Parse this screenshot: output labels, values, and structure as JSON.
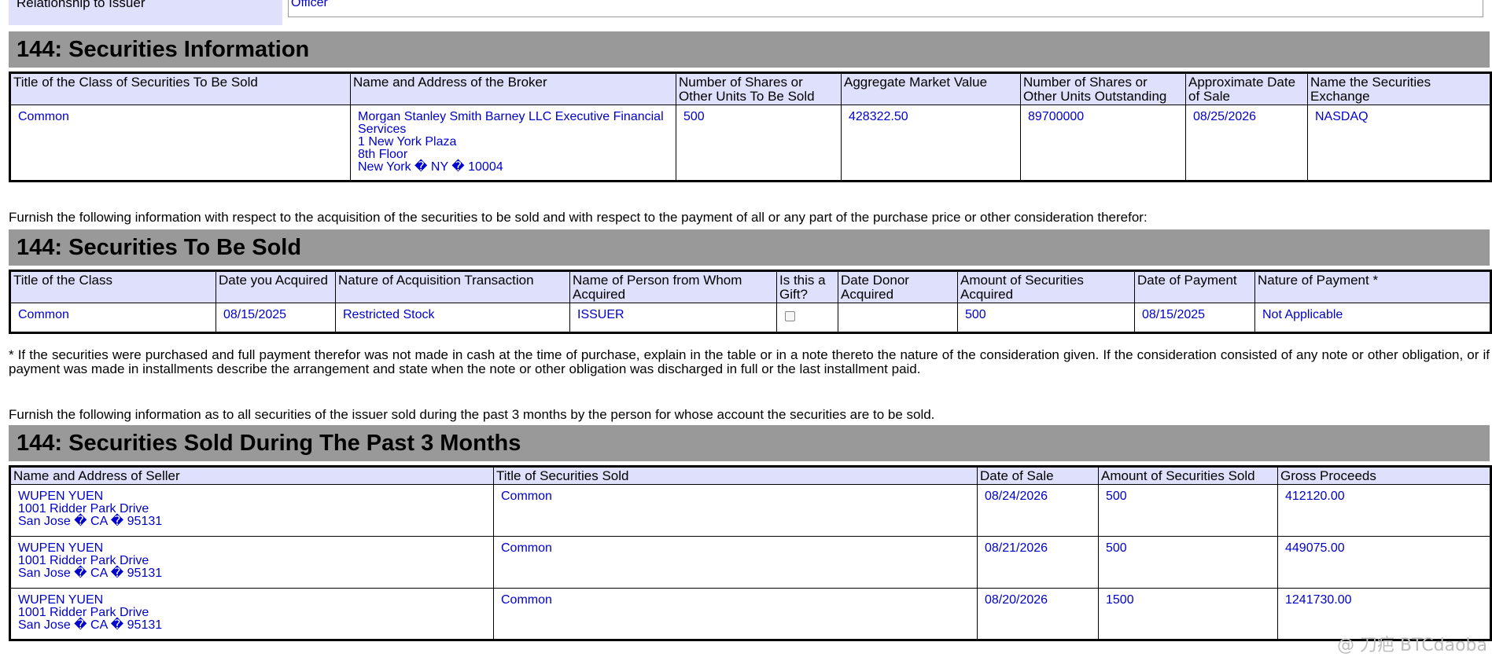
{
  "relationship": {
    "label": "Relationship to Issuer",
    "value": "Officer"
  },
  "securities_info": {
    "title": "144: Securities Information",
    "headers": [
      "Title of the Class of Securities To Be Sold",
      "Name and Address of the Broker",
      "Number of Shares or Other Units To Be Sold",
      "Aggregate Market Value",
      "Number of Shares or Other Units Outstanding",
      "Approximate Date of Sale",
      "Name the Securities Exchange"
    ],
    "row": {
      "class": "Common",
      "broker_name": "Morgan Stanley Smith Barney LLC Executive Financial Services",
      "broker_addr1": "1 New York Plaza",
      "broker_addr2": "8th Floor",
      "broker_addr3": "New York � NY � 10004",
      "shares": "500",
      "market_value": "428322.50",
      "outstanding": "89700000",
      "date": "08/25/2026",
      "exchange": "NASDAQ"
    }
  },
  "furnish_text_1": "Furnish the following information with respect to the acquisition of the securities to be sold and with respect to the payment of all or any part of the purchase price or other consideration therefor:",
  "to_be_sold": {
    "title": "144: Securities To Be Sold",
    "headers": [
      "Title of the Class",
      "Date you Acquired",
      "Nature of Acquisition Transaction",
      "Name of Person from Whom Acquired",
      "Is this a Gift?",
      "Date Donor Acquired",
      "Amount of Securities Acquired",
      "Date of Payment",
      "Nature of Payment *"
    ],
    "row": {
      "class": "Common",
      "date_acquired": "08/15/2025",
      "nature": "Restricted Stock",
      "person": "ISSUER",
      "gift": false,
      "donor_date": "",
      "amount": "500",
      "payment_date": "08/15/2025",
      "payment_nature": "Not Applicable"
    }
  },
  "footnote": "* If the securities were purchased and full payment therefor was not made in cash at the time of purchase, explain in the table or in a note thereto the nature of the consideration given. If the consideration consisted of any note or other obligation, or if payment was made in installments describe the arrangement and state when the note or other obligation was discharged in full or the last installment paid.",
  "furnish_text_2": "Furnish the following information as to all securities of the issuer sold during the past 3 months by the person for whose account the securities are to be sold.",
  "past_3_months": {
    "title": "144: Securities Sold During The Past 3 Months",
    "headers": [
      "Name and Address of Seller",
      "Title of Securities Sold",
      "Date of Sale",
      "Amount of Securities Sold",
      "Gross Proceeds"
    ],
    "rows": [
      {
        "name": "WUPEN YUEN",
        "addr1": "1001 Ridder Park Drive",
        "addr2": "San Jose � CA � 95131",
        "title": "Common",
        "date": "08/24/2026",
        "amount": "500",
        "proceeds": "412120.00"
      },
      {
        "name": "WUPEN YUEN",
        "addr1": "1001 Ridder Park Drive",
        "addr2": "San Jose � CA � 95131",
        "title": "Common",
        "date": "08/21/2026",
        "amount": "500",
        "proceeds": "449075.00"
      },
      {
        "name": "WUPEN YUEN",
        "addr1": "1001 Ridder Park Drive",
        "addr2": "San Jose � CA � 95131",
        "title": "Common",
        "date": "08/20/2026",
        "amount": "1500",
        "proceeds": "1241730.00"
      }
    ]
  },
  "watermark": "@ 刀疤 BTCdaoba"
}
